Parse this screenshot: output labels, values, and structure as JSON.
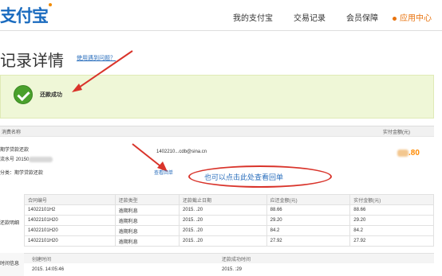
{
  "header": {
    "logo": "支付宝",
    "nav": [
      "我的支付宝",
      "交易记录",
      "会员保障",
      "应用中心"
    ]
  },
  "page": {
    "title": "记录详情",
    "help_link": "使用遇到问题？",
    "success_text": "还款成功"
  },
  "summary": {
    "col_name": "消费名称",
    "col_amount": "实付金额(元)",
    "item_name": "期学贷款还款",
    "order_label": "流水号",
    "order_value": "20150",
    "account": "1402210...cdb@sina.cn",
    "amount_suffix": ".80",
    "category": "分类：期学贷款还款",
    "receipt_link": "查看回单"
  },
  "annotation": {
    "text": "也可以点击此处查看回单",
    "color": "#d9342b"
  },
  "details": {
    "side_label": "还款明细",
    "headers": [
      "合同编号",
      "还款类型",
      "还款截止日期",
      "应还金额(元)",
      "实付金额(元)"
    ],
    "rows": [
      [
        "14022101H2",
        "逾期利息",
        "2015.  .20",
        "88.66",
        "88.66"
      ],
      [
        "14022101H20",
        "逾期利息",
        "2015.  .20",
        "29.20",
        "29.20"
      ],
      [
        "14022101H20",
        "逾期利息",
        "2015.  .20",
        "84.2",
        "84.2"
      ],
      [
        "14022101H20",
        "逾期利息",
        "2015.  .20",
        "27.92",
        "27.92"
      ]
    ]
  },
  "time": {
    "side_label": "时间信息",
    "created_label": "创建时间",
    "created_value": "2015.  14:05:46",
    "paid_label": "还款成功时间",
    "paid_value": "2015.  :29"
  }
}
